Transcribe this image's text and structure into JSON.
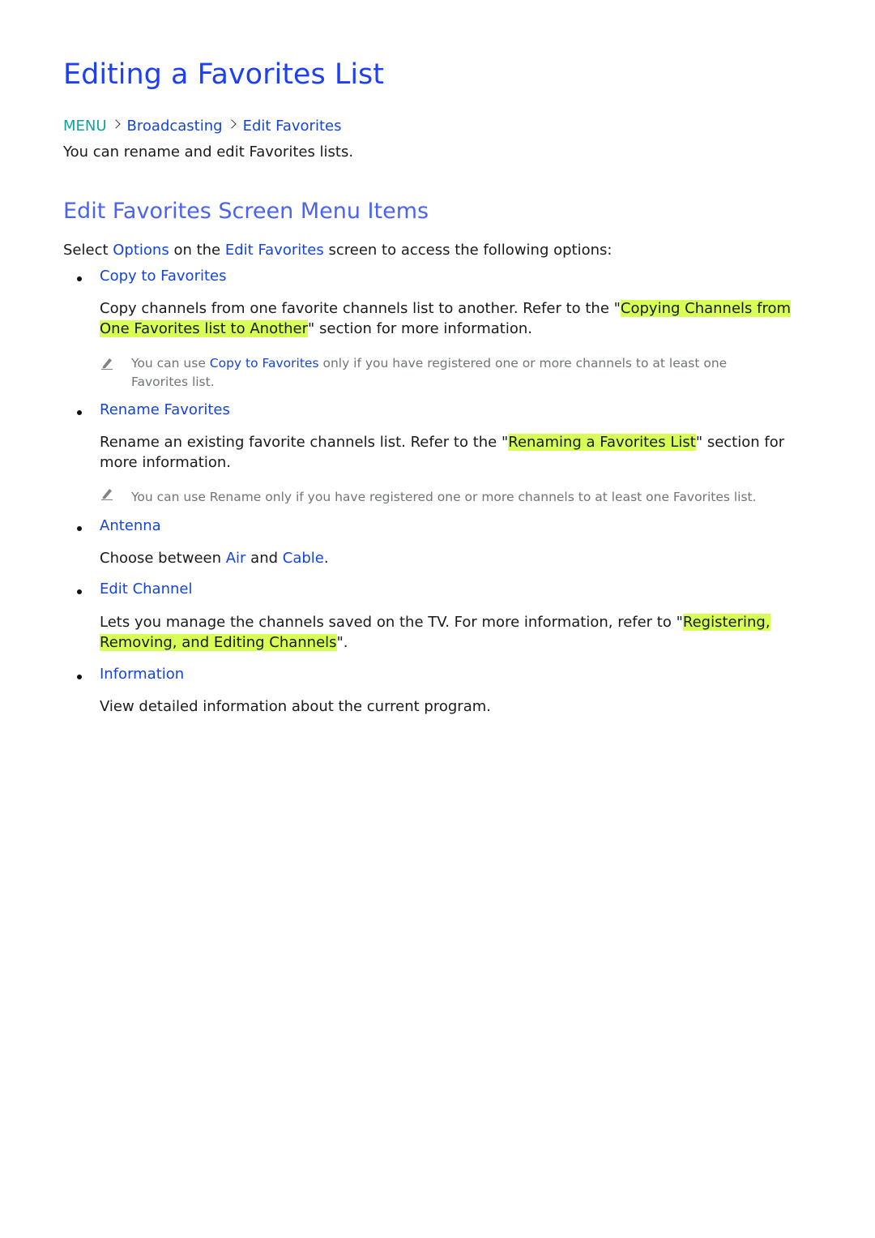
{
  "title": "Editing a Favorites List",
  "breadcrumb": {
    "root": "MENU",
    "items": [
      "Broadcasting",
      "Edit Favorites"
    ]
  },
  "intro": "You can rename and edit Favorites lists.",
  "section_title": "Edit Favorites Screen Menu Items",
  "lead": {
    "prefix": "Select ",
    "options_link": "Options",
    "middle": " on the ",
    "edit_link": "Edit Favorites",
    "suffix": " screen to access the following options:"
  },
  "items": [
    {
      "title": "Copy to Favorites",
      "desc_prefix": "Copy channels from one favorite channels list to another. Refer to the \"",
      "desc_highlight_1": "Copying Channels from ",
      "desc_highlight_2": "One Favorites list to Another",
      "desc_suffix": "\" section for more information.",
      "note_prefix": "You can use ",
      "note_link": "Copy to Favorites",
      "note_suffix": " only if you have registered one or more channels to at least one Favorites list."
    },
    {
      "title": "Rename Favorites",
      "desc_prefix": "Rename an existing favorite channels list. Refer to the \"",
      "desc_highlight": "Renaming a Favorites List",
      "desc_suffix": "\" section for more information.",
      "note": "You can use Rename only if you have registered one or more channels to at least one Favorites list."
    },
    {
      "title": "Antenna",
      "desc_prefix": "Choose between ",
      "air": "Air",
      "and": " and ",
      "cable": "Cable",
      "period": "."
    },
    {
      "title": "Edit Channel",
      "desc_prefix": "Lets you manage the channels saved on the TV. For more information, refer to \"",
      "desc_highlight_1": "Registering, ",
      "desc_highlight_2": "Removing, and Editing Channels",
      "desc_suffix": "\"."
    },
    {
      "title": "Information",
      "desc": "View detailed information about the current program."
    }
  ],
  "colors": {
    "title": "#1f3ff5",
    "section_title": "#4a63f2",
    "menu": "#12a39b",
    "link": "#1444e0",
    "highlight": "#d8ff55",
    "note_text": "#6f7578"
  }
}
